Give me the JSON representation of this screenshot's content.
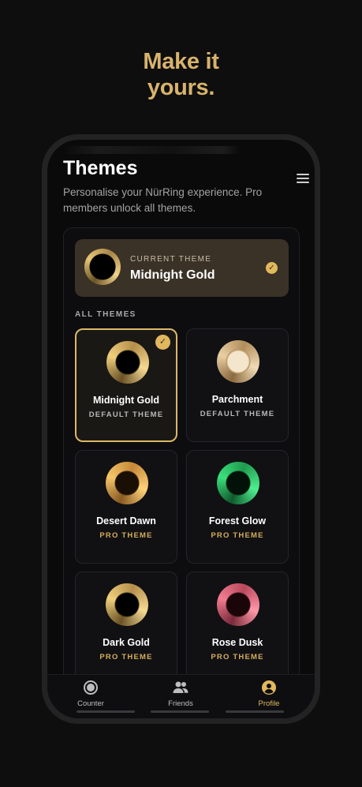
{
  "headline": {
    "line1": "Make it",
    "line2": "yours."
  },
  "header": {
    "title": "Themes",
    "subtitle": "Personalise your NürRing experience. Pro members unlock all themes."
  },
  "current_theme": {
    "label": "CURRENT THEME",
    "name": "Midnight Gold"
  },
  "all_themes_label": "ALL THEMES",
  "themes": [
    {
      "name": "Midnight Gold",
      "tag": "DEFAULT THEME",
      "tier": "default",
      "selected": true
    },
    {
      "name": "Parchment",
      "tag": "DEFAULT THEME",
      "tier": "default",
      "selected": false
    },
    {
      "name": "Desert Dawn",
      "tag": "PRO THEME",
      "tier": "pro",
      "selected": false
    },
    {
      "name": "Forest Glow",
      "tag": "PRO THEME",
      "tier": "pro",
      "selected": false
    },
    {
      "name": "Dark Gold",
      "tag": "PRO THEME",
      "tier": "pro",
      "selected": false
    },
    {
      "name": "Rose Dusk",
      "tag": "PRO THEME",
      "tier": "pro",
      "selected": false
    }
  ],
  "nav": [
    {
      "label": "Counter",
      "icon": "counter-icon",
      "active": false
    },
    {
      "label": "Friends",
      "icon": "friends-icon",
      "active": false
    },
    {
      "label": "Profile",
      "icon": "profile-icon",
      "active": true
    }
  ],
  "colors": {
    "accent": "#e2b85e",
    "headline": "#d8b36c",
    "background": "#0e0e0e"
  }
}
